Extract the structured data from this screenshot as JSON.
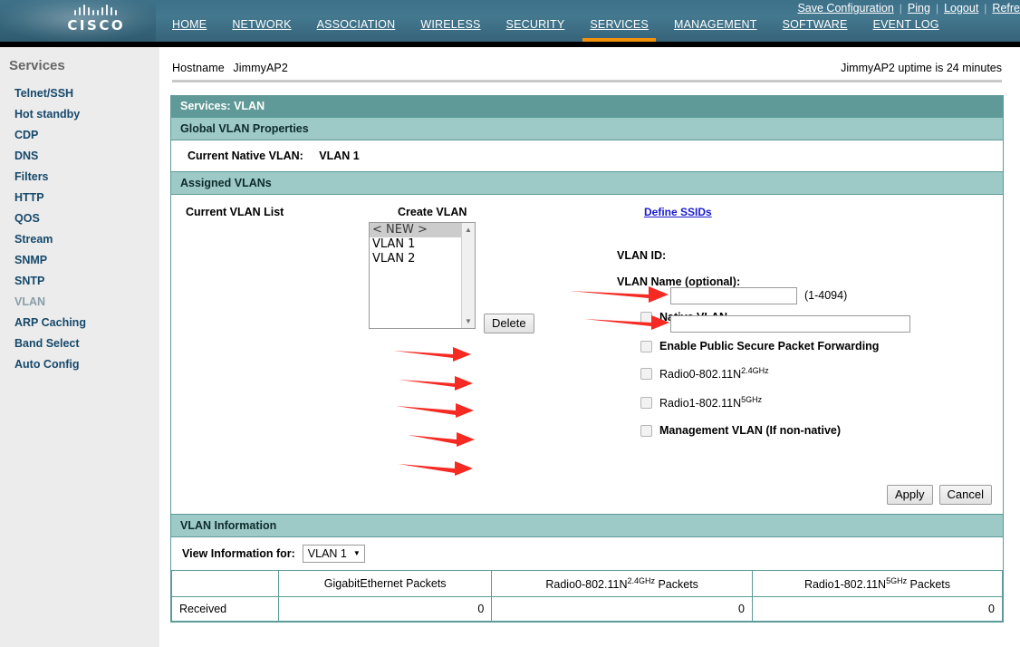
{
  "brand": {
    "name": "CISCO",
    "logo_icon": "cisco-logo-icon"
  },
  "top_links": [
    {
      "label": "Save Configuration",
      "accesskey": "v"
    },
    {
      "label": "Ping",
      "accesskey": "P"
    },
    {
      "label": "Logout",
      "accesskey": "o"
    },
    {
      "label": "Refre",
      "accesskey": "R"
    }
  ],
  "mainnav": [
    {
      "label": "HOME",
      "accesskey": "H",
      "active": false
    },
    {
      "label": "NETWORK",
      "accesskey": "N",
      "active": false
    },
    {
      "label": "ASSOCIATION",
      "accesskey": "A",
      "active": false
    },
    {
      "label": "WIRELESS",
      "accesskey": "I",
      "active": false
    },
    {
      "label": "SECURITY",
      "accesskey": "S",
      "active": false
    },
    {
      "label": "SERVICES",
      "accesskey": "S",
      "active": true
    },
    {
      "label": "MANAGEMENT",
      "accesskey": "M",
      "active": false
    },
    {
      "label": "SOFTWARE",
      "accesskey": "S",
      "active": false
    },
    {
      "label": "EVENT LOG",
      "accesskey": "E",
      "active": false
    }
  ],
  "sidebar": {
    "title": "Services",
    "items": [
      {
        "label": "Telnet/SSH",
        "current": false
      },
      {
        "label": "Hot standby",
        "current": false
      },
      {
        "label": "CDP",
        "current": false
      },
      {
        "label": "DNS",
        "current": false
      },
      {
        "label": "Filters",
        "current": false
      },
      {
        "label": "HTTP",
        "current": false
      },
      {
        "label": "QOS",
        "current": false
      },
      {
        "label": "Stream",
        "current": false
      },
      {
        "label": "SNMP",
        "current": false
      },
      {
        "label": "SNTP",
        "current": false
      },
      {
        "label": "VLAN",
        "current": true
      },
      {
        "label": "ARP Caching",
        "current": false
      },
      {
        "label": "Band Select",
        "current": false
      },
      {
        "label": "Auto Config",
        "current": false
      }
    ]
  },
  "hostbar": {
    "hostname_label": "Hostname",
    "hostname_value": "JimmyAP2",
    "uptime": "JimmyAP2 uptime is 24 minutes"
  },
  "panel": {
    "title": "Services: VLAN",
    "global_section": {
      "title": "Global VLAN Properties",
      "native_label": "Current Native VLAN:",
      "native_value": "VLAN 1"
    },
    "assigned_section": {
      "title": "Assigned VLANs",
      "current_list_heading": "Current VLAN List",
      "create_heading": "Create VLAN",
      "define_ssids_link": "Define SSIDs",
      "vlan_list": [
        {
          "label": "< NEW >",
          "selected": true
        },
        {
          "label": "VLAN 1",
          "selected": false
        },
        {
          "label": "VLAN 2",
          "selected": false
        }
      ],
      "delete_button": "Delete",
      "vlan_id_label": "VLAN ID:",
      "vlan_id_value": "",
      "vlan_id_hint": "(1-4094)",
      "vlan_name_label": "VLAN Name (optional):",
      "vlan_name_value": "",
      "checkboxes": [
        {
          "label": "Native VLAN",
          "checked": false,
          "style": "bold"
        },
        {
          "label": "Enable Public Secure Packet Forwarding",
          "checked": false,
          "style": "bold"
        },
        {
          "label": "Radio0-802.11N",
          "sup": "2.4GHz",
          "checked": false,
          "style": "plain"
        },
        {
          "label": "Radio1-802.11N",
          "sup": "5GHz",
          "checked": false,
          "style": "plain"
        },
        {
          "label": "Management VLAN (If non-native)",
          "checked": false,
          "style": "bold"
        }
      ],
      "apply_button": "Apply",
      "cancel_button": "Cancel"
    },
    "info_section": {
      "title": "VLAN Information",
      "view_for_label": "View Information for:",
      "view_for_value": "VLAN 1",
      "table": {
        "columns": [
          "",
          "GigabitEthernet Packets",
          "Radio0-802.11N2.4GHz Packets",
          "Radio1-802.11N5GHz Packets"
        ],
        "col1": "GigabitEthernet Packets",
        "col2_base": "Radio0-802.11N",
        "col2_sup": "2.4GHz",
        "col2_tail": " Packets",
        "col3_base": "Radio1-802.11N",
        "col3_sup": "5GHz",
        "col3_tail": " Packets",
        "rows": [
          {
            "label": "Received",
            "values": [
              "0",
              "0",
              "0"
            ]
          }
        ]
      }
    }
  },
  "annotations": {
    "arrow_color": "#f52a22",
    "count": 7
  },
  "colors": {
    "nav_bg": "#3d7089",
    "accent_orange": "#f2910b",
    "band_main": "#5f9a98",
    "band_sub": "#9dc9c6",
    "sidebar_bg": "#ececec",
    "sidebar_link": "#16496b",
    "link_blue": "#1a1ad0"
  }
}
